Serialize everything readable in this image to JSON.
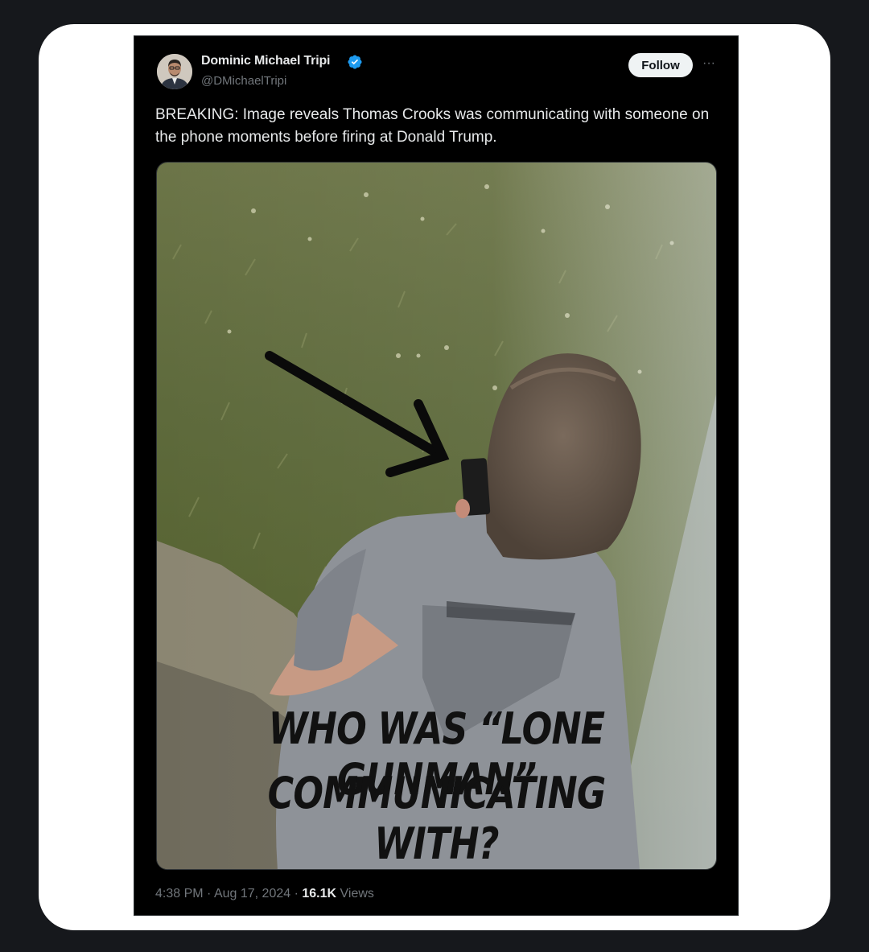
{
  "author": {
    "name": "Dominic Michael Tripi",
    "handle": "@DMichaelTripi"
  },
  "follow_label": "Follow",
  "more_label": "···",
  "tweet_text": "BREAKING: Image reveals Thomas Crooks was communicating with someone on the phone moments before firing at Donald Trump.",
  "media": {
    "caption_line1": "WHO WAS “LONE GUNMAN”",
    "caption_line2": "COMMUNICATING WITH?"
  },
  "meta": {
    "time": "4:38 PM",
    "date": "Aug 17, 2024",
    "separator": "·",
    "views_count": "16.1K",
    "views_label": "Views"
  },
  "colors": {
    "verified": "#1d9bf0",
    "follow_bg": "#eff3f4",
    "text_primary": "#e7e9ea",
    "text_secondary": "#71767b"
  }
}
